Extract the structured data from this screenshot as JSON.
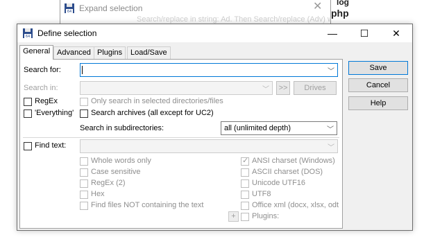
{
  "background_window": {
    "title": "Expand selection",
    "text_fragment": "Search/replace in string: Ad. Then Search/replace (Adv) with...",
    "right_texts": [
      "log",
      "php"
    ]
  },
  "dialog": {
    "title": "Define selection",
    "controls": {
      "minimize": "—",
      "maximize": "☐",
      "close": "✕"
    }
  },
  "tabs": [
    {
      "label": "General",
      "active": true
    },
    {
      "label": "Advanced",
      "active": false
    },
    {
      "label": "Plugins",
      "active": false
    },
    {
      "label": "Load/Save",
      "active": false
    }
  ],
  "general": {
    "search_for_label": "Search for:",
    "search_for_value": "",
    "search_in_label": "Search in:",
    "search_in_value": "",
    "browse_label": ">>",
    "drives_label": "Drives",
    "only_selected": "Only search in selected directories/files",
    "regex": "RegEx",
    "everything": "'Everything'",
    "search_archives": "Search archives (all except for UC2)",
    "subdirs_label": "Search in subdirectories:",
    "subdirs_value": "all (unlimited depth)",
    "find_text": "Find text:",
    "find_text_value": "",
    "whole_words": "Whole words only",
    "case_sensitive": "Case sensitive",
    "regex2": "RegEx (2)",
    "hex": "Hex",
    "not_containing": "Find files NOT containing the text",
    "ansi": "ANSI charset (Windows)",
    "ascii": "ASCII charset (DOS)",
    "unicode": "Unicode UTF16",
    "utf8": "UTF8",
    "office": "Office xml (docx, xlsx, odt etc.)",
    "plus": "+",
    "plugins": "Plugins:"
  },
  "buttons": {
    "save": "Save",
    "cancel": "Cancel",
    "help": "Help"
  },
  "colors": {
    "accent": "#0078d7",
    "dialog_bg": "#f0f0f0",
    "panel_bg": "#ffffff"
  }
}
